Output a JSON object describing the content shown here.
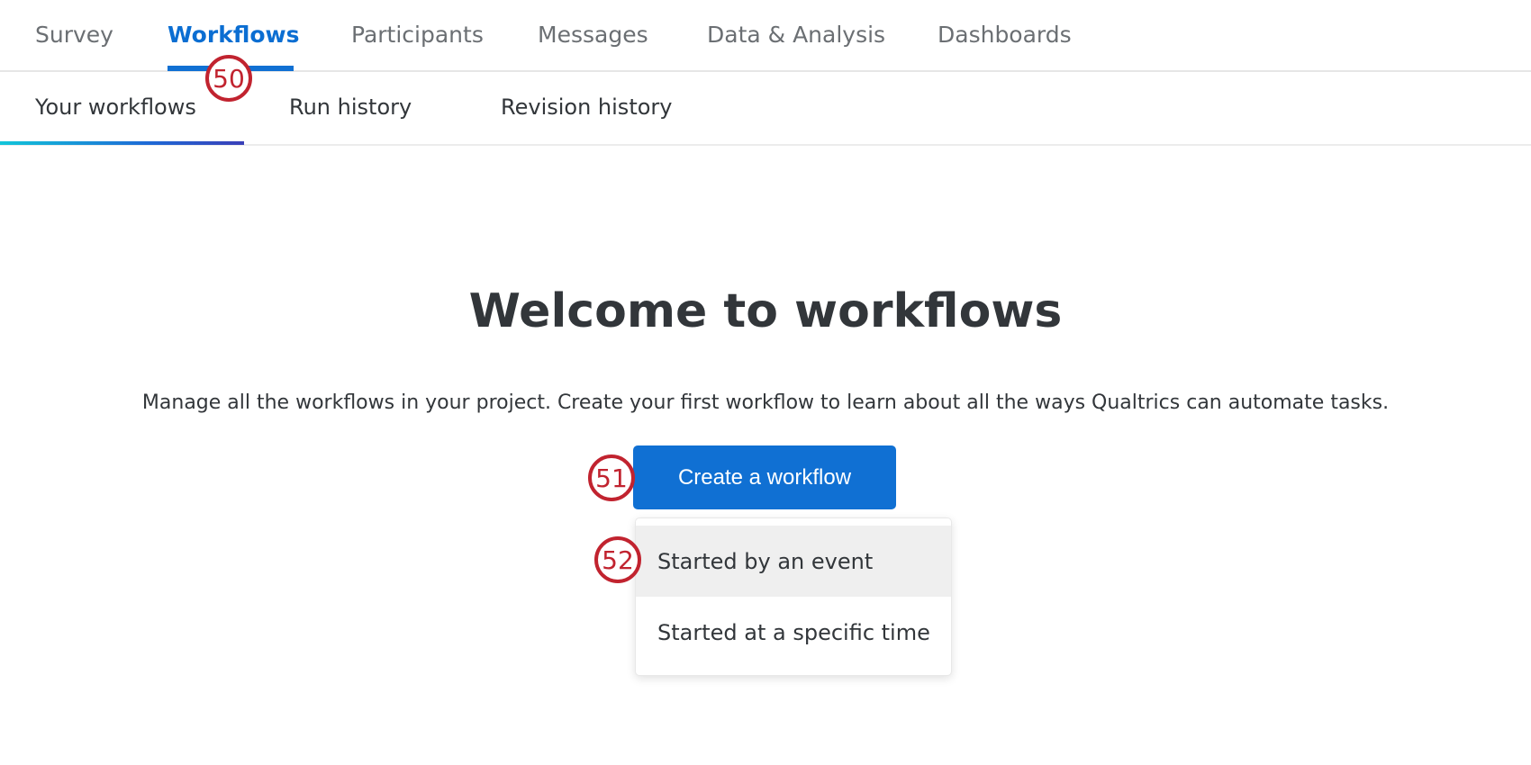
{
  "top_tabs": [
    "Survey",
    "Workflows",
    "Participants",
    "Messages",
    "Data & Analysis",
    "Dashboards"
  ],
  "active_top_tab": "Workflows",
  "sub_tabs": [
    "Your workflows",
    "Run history",
    "Revision history"
  ],
  "active_sub_tab": "Your workflows",
  "main": {
    "title": "Welcome to workflows",
    "description": "Manage all the workflows in your project. Create your first workflow to learn about all the ways Qualtrics can automate tasks.",
    "create_button": "Create a workflow",
    "menu_items": [
      "Started by an event",
      "Started at a specific time"
    ]
  },
  "annotations": [
    "50",
    "51",
    "52"
  ],
  "colors": {
    "accent": "#1070d3",
    "badge": "#c1232f"
  }
}
